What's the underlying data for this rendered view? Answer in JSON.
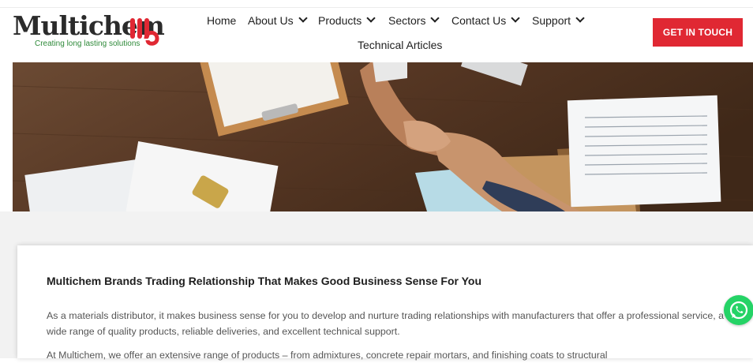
{
  "brand": {
    "logo_text": "Multichem",
    "tagline": "Creating long lasting solutions"
  },
  "nav": {
    "items": [
      {
        "label": "Home",
        "has_dropdown": false
      },
      {
        "label": "About Us",
        "has_dropdown": true
      },
      {
        "label": "Products",
        "has_dropdown": true
      },
      {
        "label": "Sectors",
        "has_dropdown": true
      },
      {
        "label": "Contact Us",
        "has_dropdown": true
      },
      {
        "label": "Support",
        "has_dropdown": true
      },
      {
        "label": "Technical Articles",
        "has_dropdown": false
      }
    ],
    "cta_label": "GET IN TOUCH"
  },
  "content": {
    "title": "Multichem Brands Trading Relationship That Makes Good Business Sense For You",
    "paragraph_1": "As a materials distributor, it makes business sense for you to develop and nurture trading relationships with manufacturers that offer a professional service, a wide range of quality products, reliable deliveries, and excellent technical support.",
    "paragraph_2": "At Multichem, we offer an extensive range of products – from admixtures, concrete repair mortars, and finishing coats to structural"
  },
  "colors": {
    "accent": "#e02833",
    "brand_green": "#2f8a3a",
    "whatsapp": "#25d366"
  },
  "icons": [
    "whatsapp-icon",
    "chevron-down-icon"
  ]
}
